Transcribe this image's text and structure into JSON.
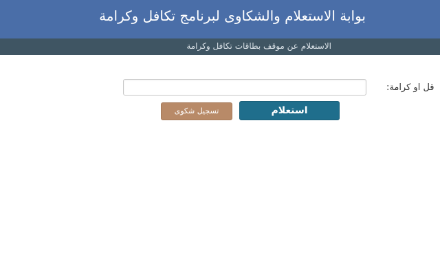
{
  "header": {
    "title": "بوابة الاستعلام والشكاوى لبرنامج تكافل وكرامة"
  },
  "subheader": {
    "text": "الاستعلام عن موقف بطاقات تكافل وكرامة"
  },
  "form": {
    "field_label": "قل او كرامة:",
    "field_value": "",
    "field_placeholder": "",
    "inquiry_button": "استعلام",
    "complaint_button": "تسجيل شكوى"
  },
  "colors": {
    "header_bg": "#4a6ea8",
    "subheader_bg": "#3f5563",
    "inquiry_button": "#1f6e8c",
    "complaint_button": "#b88a68"
  }
}
